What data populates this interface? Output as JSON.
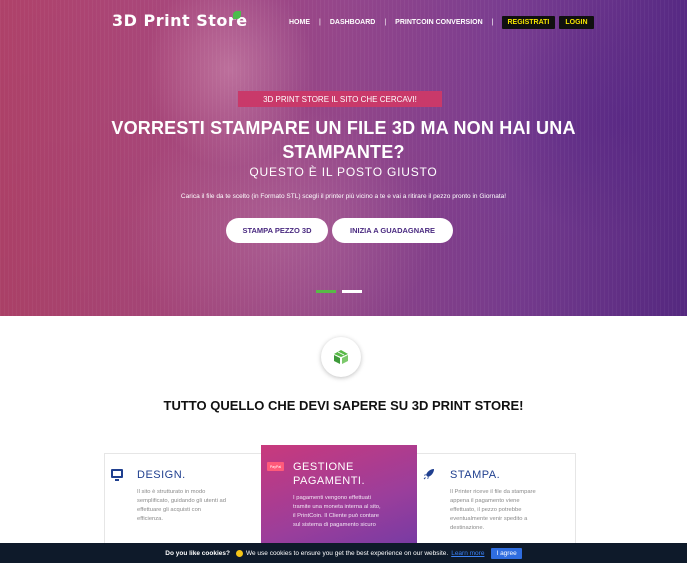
{
  "brand": {
    "logo_text": "3D Print Store"
  },
  "nav": {
    "items": [
      "HOME",
      "DASHBOARD",
      "PRINTCOIN CONVERSION"
    ],
    "separator": "|",
    "register_label": "REGISTRATI",
    "login_label": "LOGIN"
  },
  "hero": {
    "tagline": "3D PRINT STORE IL SITO CHE CERCAVI!",
    "title_line1": "VORRESTI STAMPARE UN FILE 3D MA NON HAI UNA",
    "title_line2": "STAMPANTE?",
    "subtitle": "QUESTO È IL POSTO GIUSTO",
    "description": "Carica il file da te scelto (in Formato STL) scegli il printer più vicino a te e vai a ritirare il pezzo pronto in Giornata!",
    "cta_primary": "STAMPA PEZZO 3D",
    "cta_secondary": "INIZIA A GUADAGNARE",
    "slides": {
      "count": 2,
      "active": 1
    }
  },
  "section": {
    "title": "TUTTO QUELLO CHE DEVI SAPERE SU 3D PRINT STORE!"
  },
  "features": [
    {
      "title": "DESIGN.",
      "text_lines": [
        "Il sito è strutturato in modo",
        "semplificato, guidando gli utenti ad",
        "effettuare gli acquisti con",
        "efficienza."
      ],
      "icon": "monitor-icon"
    },
    {
      "title_line1": "GESTIONE",
      "title_line2": "PAGAMENTI.",
      "text_lines": [
        "I pagamenti vengono effettuati",
        "tramite una moneta interna al sito,",
        "il PrintCoin. Il Cliente può contare",
        "sul sistema di pagamento sicuro"
      ],
      "icon": "paypal-icon",
      "icon_text": "PayPal"
    },
    {
      "title": "STAMPA.",
      "text_lines": [
        "Il Printer riceve il file da stampare",
        "appena il pagamento viene",
        "effettuato, il pezzo potrebbe",
        "eventualmente venir spedito a",
        "destinazione."
      ],
      "icon": "rocket-icon"
    }
  ],
  "cookie": {
    "question": "Do you like cookies?",
    "message": "We use cookies to ensure you get the best experience on our website.",
    "link": "Learn more",
    "button": "I agree"
  },
  "colors": {
    "accent_green": "#58b947",
    "nav_btn_text": "#f3e300",
    "tagline_bg": "#c9396a",
    "feature_title": "#1f3f8f",
    "cookie_bg": "#0e1a2a",
    "cookie_button": "#2f6de0"
  }
}
